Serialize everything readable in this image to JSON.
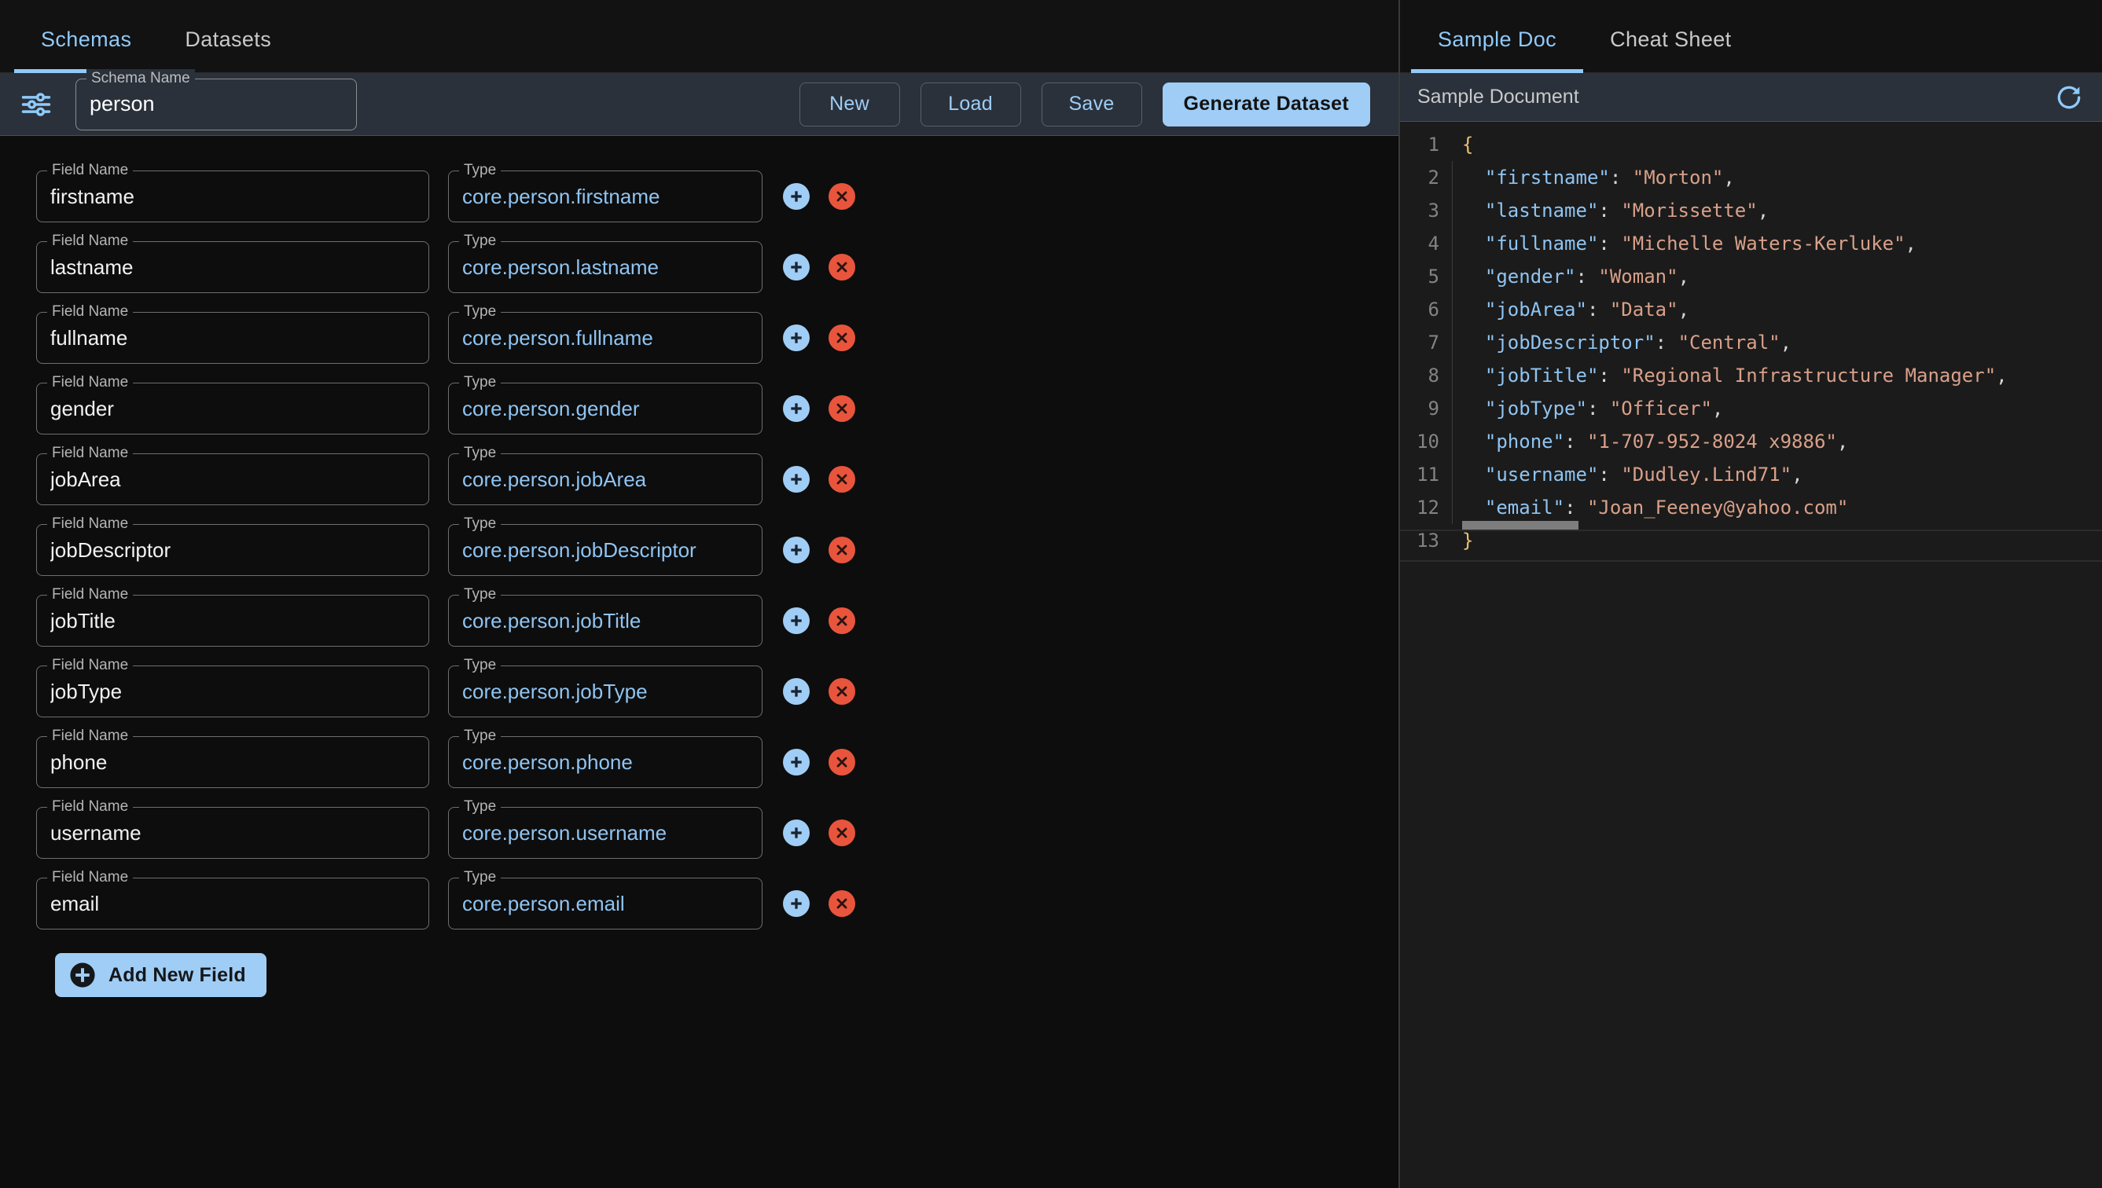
{
  "left": {
    "tabs": [
      {
        "label": "Schemas",
        "active": true
      },
      {
        "label": "Datasets",
        "active": false
      }
    ],
    "toolbar": {
      "tune_icon": "tune-icon",
      "schema_name_label": "Schema Name",
      "schema_name_value": "person",
      "schema_name_placeholder": "Schema Name",
      "new_label": "New",
      "load_label": "Load",
      "save_label": "Save",
      "generate_label": "Generate Dataset"
    },
    "field_label": "Field Name",
    "type_label": "Type",
    "add_icon": "plus-circle-icon",
    "delete_icon": "close-circle-icon",
    "fields": [
      {
        "name": "firstname",
        "type": "core.person.firstname"
      },
      {
        "name": "lastname",
        "type": "core.person.lastname"
      },
      {
        "name": "fullname",
        "type": "core.person.fullname"
      },
      {
        "name": "gender",
        "type": "core.person.gender"
      },
      {
        "name": "jobArea",
        "type": "core.person.jobArea"
      },
      {
        "name": "jobDescriptor",
        "type": "core.person.jobDescriptor"
      },
      {
        "name": "jobTitle",
        "type": "core.person.jobTitle"
      },
      {
        "name": "jobType",
        "type": "core.person.jobType"
      },
      {
        "name": "phone",
        "type": "core.person.phone"
      },
      {
        "name": "username",
        "type": "core.person.username"
      },
      {
        "name": "email",
        "type": "core.person.email"
      }
    ],
    "add_new_field_label": "Add New Field"
  },
  "right": {
    "tabs": [
      {
        "label": "Sample Doc",
        "active": true
      },
      {
        "label": "Cheat Sheet",
        "active": false
      }
    ],
    "doc_header_title": "Sample Document",
    "refresh_icon": "refresh-icon",
    "code_lines": [
      {
        "num": "1",
        "tokens": [
          {
            "t": "{",
            "c": "b"
          }
        ]
      },
      {
        "num": "2",
        "tokens": [
          {
            "t": "  ",
            "c": "p"
          },
          {
            "t": "\"firstname\"",
            "c": "k"
          },
          {
            "t": ": ",
            "c": "p"
          },
          {
            "t": "\"Morton\"",
            "c": "s"
          },
          {
            "t": ",",
            "c": "p"
          }
        ]
      },
      {
        "num": "3",
        "tokens": [
          {
            "t": "  ",
            "c": "p"
          },
          {
            "t": "\"lastname\"",
            "c": "k"
          },
          {
            "t": ": ",
            "c": "p"
          },
          {
            "t": "\"Morissette\"",
            "c": "s"
          },
          {
            "t": ",",
            "c": "p"
          }
        ]
      },
      {
        "num": "4",
        "tokens": [
          {
            "t": "  ",
            "c": "p"
          },
          {
            "t": "\"fullname\"",
            "c": "k"
          },
          {
            "t": ": ",
            "c": "p"
          },
          {
            "t": "\"Michelle Waters-Kerluke\"",
            "c": "s"
          },
          {
            "t": ",",
            "c": "p"
          }
        ]
      },
      {
        "num": "5",
        "tokens": [
          {
            "t": "  ",
            "c": "p"
          },
          {
            "t": "\"gender\"",
            "c": "k"
          },
          {
            "t": ": ",
            "c": "p"
          },
          {
            "t": "\"Woman\"",
            "c": "s"
          },
          {
            "t": ",",
            "c": "p"
          }
        ]
      },
      {
        "num": "6",
        "tokens": [
          {
            "t": "  ",
            "c": "p"
          },
          {
            "t": "\"jobArea\"",
            "c": "k"
          },
          {
            "t": ": ",
            "c": "p"
          },
          {
            "t": "\"Data\"",
            "c": "s"
          },
          {
            "t": ",",
            "c": "p"
          }
        ]
      },
      {
        "num": "7",
        "tokens": [
          {
            "t": "  ",
            "c": "p"
          },
          {
            "t": "\"jobDescriptor\"",
            "c": "k"
          },
          {
            "t": ": ",
            "c": "p"
          },
          {
            "t": "\"Central\"",
            "c": "s"
          },
          {
            "t": ",",
            "c": "p"
          }
        ]
      },
      {
        "num": "8",
        "tokens": [
          {
            "t": "  ",
            "c": "p"
          },
          {
            "t": "\"jobTitle\"",
            "c": "k"
          },
          {
            "t": ": ",
            "c": "p"
          },
          {
            "t": "\"Regional Infrastructure Manager\"",
            "c": "s"
          },
          {
            "t": ",",
            "c": "p"
          }
        ]
      },
      {
        "num": "9",
        "tokens": [
          {
            "t": "  ",
            "c": "p"
          },
          {
            "t": "\"jobType\"",
            "c": "k"
          },
          {
            "t": ": ",
            "c": "p"
          },
          {
            "t": "\"Officer\"",
            "c": "s"
          },
          {
            "t": ",",
            "c": "p"
          }
        ]
      },
      {
        "num": "10",
        "tokens": [
          {
            "t": "  ",
            "c": "p"
          },
          {
            "t": "\"phone\"",
            "c": "k"
          },
          {
            "t": ": ",
            "c": "p"
          },
          {
            "t": "\"1-707-952-8024 x9886\"",
            "c": "s"
          },
          {
            "t": ",",
            "c": "p"
          }
        ]
      },
      {
        "num": "11",
        "tokens": [
          {
            "t": "  ",
            "c": "p"
          },
          {
            "t": "\"username\"",
            "c": "k"
          },
          {
            "t": ": ",
            "c": "p"
          },
          {
            "t": "\"Dudley.Lind71\"",
            "c": "s"
          },
          {
            "t": ",",
            "c": "p"
          }
        ]
      },
      {
        "num": "12",
        "tokens": [
          {
            "t": "  ",
            "c": "p"
          },
          {
            "t": "\"email\"",
            "c": "k"
          },
          {
            "t": ": ",
            "c": "p"
          },
          {
            "t": "\"Joan_Feeney@yahoo.com\"",
            "c": "s"
          }
        ]
      },
      {
        "num": "13",
        "tokens": [
          {
            "t": "}",
            "c": "b"
          }
        ]
      }
    ],
    "sample_document": {
      "firstname": "Morton",
      "lastname": "Morissette",
      "fullname": "Michelle Waters-Kerluke",
      "gender": "Woman",
      "jobArea": "Data",
      "jobDescriptor": "Central",
      "jobTitle": "Regional Infrastructure Manager",
      "jobType": "Officer",
      "phone": "1-707-952-8024 x9886",
      "username": "Dudley.Lind71",
      "email": "Joan_Feeney@yahoo.com"
    }
  },
  "colors": {
    "accent": "#90caf9",
    "accent_button": "#9fcdf5",
    "danger": "#e8553c",
    "toolbar_bg": "#2a313b",
    "panel_bg": "#0d0d0d",
    "code_bg": "#1b1b1b",
    "json_key": "#8fc4f2",
    "json_string": "#d9a08a",
    "json_brace": "#e8c172"
  }
}
